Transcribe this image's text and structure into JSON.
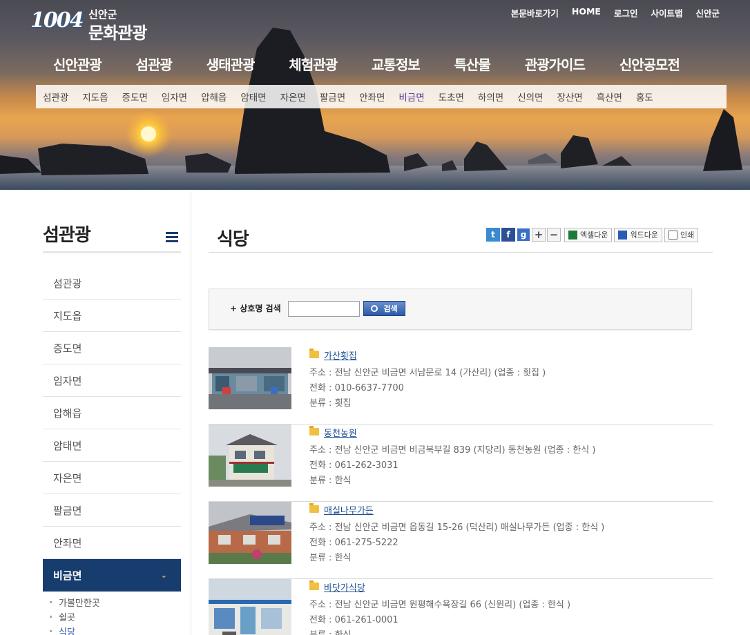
{
  "header": {
    "logo_number": "1004",
    "logo_sub": "신안군",
    "logo_main": "문화관광",
    "util_links": [
      "본문바로가기",
      "HOME",
      "로그인",
      "사이트맵",
      "신안군"
    ],
    "main_nav": [
      "신안관광",
      "섬관광",
      "생태관광",
      "체험관광",
      "교통정보",
      "특산물",
      "관광가이드",
      "신안공모전"
    ],
    "sub_nav": [
      "섬관광",
      "지도읍",
      "증도면",
      "임자면",
      "압해읍",
      "암태면",
      "자은면",
      "팔금면",
      "안좌면",
      "비금면",
      "도초면",
      "하의면",
      "신의면",
      "장산면",
      "흑산면",
      "홍도"
    ],
    "sub_nav_active": "비금면"
  },
  "sidebar": {
    "title": "섬관광",
    "items": [
      "섬관광",
      "지도읍",
      "증도면",
      "임자면",
      "압해읍",
      "암태면",
      "자은면",
      "팔금면",
      "안좌면"
    ],
    "active_item": "비금면",
    "sub_items": [
      "가볼만한곳",
      "쉴곳",
      "식당"
    ],
    "sub_active": "식당"
  },
  "content": {
    "title": "식당",
    "tools": {
      "excel": "엑셀다운",
      "word": "워드다운",
      "print": "인쇄"
    },
    "search": {
      "label": "+ 상호명 검색",
      "value": "",
      "button": "검색"
    },
    "restaurants": [
      {
        "name": "가산횟집",
        "address": "주소 : 전남 신안군 비금면 서남문로 14 (가산리)  (업종 : 횟집 )",
        "phone": "전화 : 010-6637-7700",
        "category": "분류 : 횟집"
      },
      {
        "name": "동천농원",
        "address": "주소 : 전남 신안군 비금면 비금북부길 839 (지당리) 동천농원  (업종 : 한식 )",
        "phone": "전화 : 061-262-3031",
        "category": "분류 : 한식"
      },
      {
        "name": "매실나무가든",
        "address": "주소 : 전남 신안군 비금면 읍동길 15-26 (덕산리) 매실나무가든  (업종 : 한식 )",
        "phone": "전화 : 061-275-5222",
        "category": "분류 : 한식"
      },
      {
        "name": "바닷가식당",
        "address": "주소 : 전남 신안군 비금면 원평해수욕장길 66 (신원리)  (업종 : 한식 )",
        "phone": "전화 : 061-261-0001",
        "category": "분류 : 한식"
      }
    ]
  },
  "colors": {
    "sidebar_active": "#173c6e",
    "link": "#1d4f94",
    "search_button": "#2c5aa8"
  }
}
